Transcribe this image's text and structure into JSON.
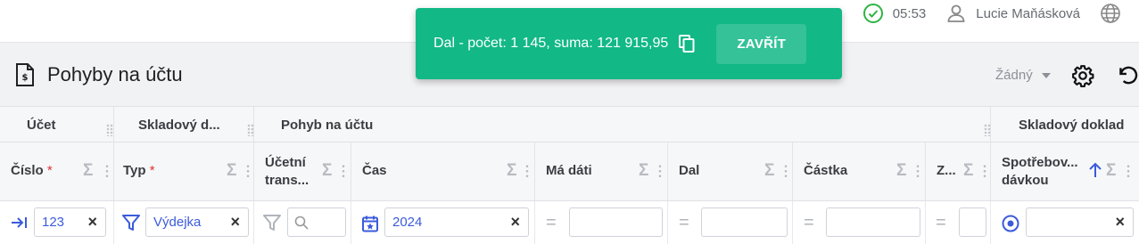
{
  "header": {
    "time": "05:53",
    "user": "Lucie Maňásková"
  },
  "toast": {
    "message": "Dal - počet: 1 145, suma: 121 915,95",
    "close_label": "ZAVŘÍT",
    "color": "#12b886"
  },
  "page": {
    "title": "Pohyby na účtu",
    "preset": "Žádný"
  },
  "table": {
    "groups": [
      "Účet",
      "Skladový d...",
      "Pohyb na účtu",
      "Skladový doklad"
    ],
    "columns": [
      {
        "label": "Číslo",
        "required": "*"
      },
      {
        "label": "Typ",
        "required": "*"
      },
      {
        "label_line1": "Účetní",
        "label_line2": "trans..."
      },
      {
        "label": "Čas"
      },
      {
        "label": "Má dáti"
      },
      {
        "label": "Dal"
      },
      {
        "label": "Částka"
      },
      {
        "label": "Z..."
      },
      {
        "label_line1": "Spotřebov...",
        "label_line2": "dávkou"
      }
    ],
    "sigma": "Σ",
    "filters": {
      "cislo": "123",
      "typ": "Výdejka",
      "cas": "2024"
    }
  },
  "colors": {
    "accent": "#3b5bdb",
    "required": "#e03131",
    "success": "#12b886"
  }
}
